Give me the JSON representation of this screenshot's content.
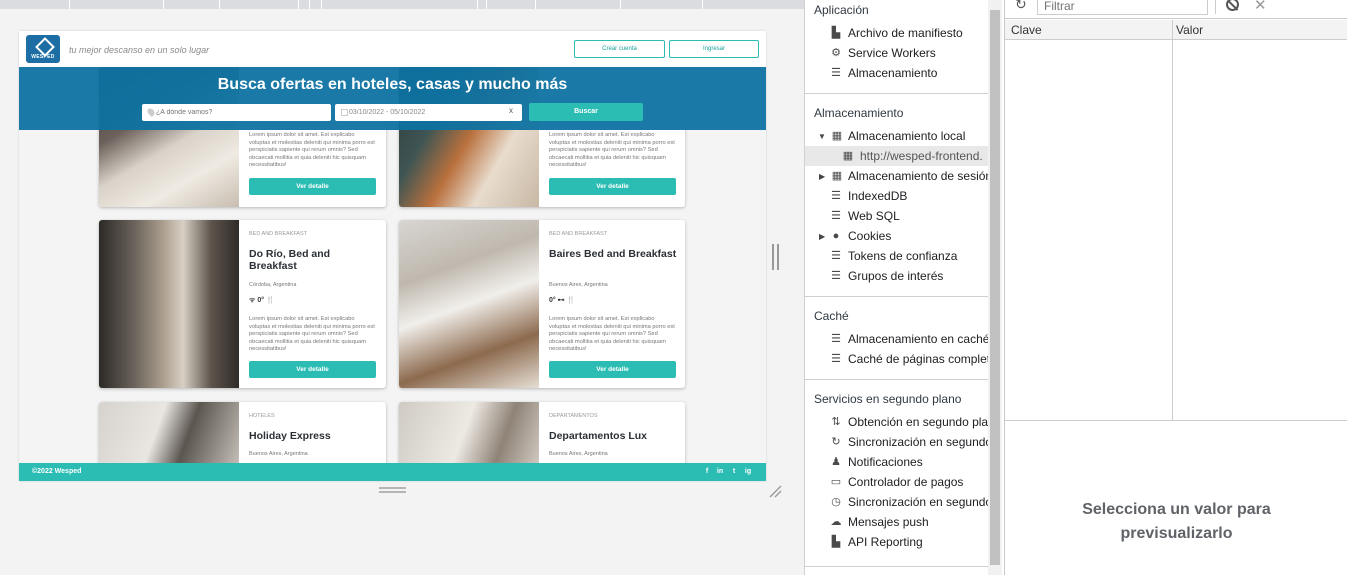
{
  "site": {
    "tagline": "tu mejor descanso en un solo lugar",
    "logo_text": "WESPED",
    "create_account": "Crear cuenta",
    "login": "Ingresar",
    "hero_title": "Busca ofertas en hoteles, casas y mucho más",
    "search_placeholder": "¿A dónde vamos?",
    "date_range": "03/10/2022 - 05/10/2022",
    "clear": "x",
    "search_button": "Buscar",
    "cards": [
      {
        "category": "",
        "name": "",
        "location": "",
        "amenities": "",
        "description": "Lorem ipsum dolor sit amet. Est explicabo voluptas et molestias deleniti qui minima porro est perspiciatis sapiente qui rerum omnis? Sed obcaecati mollitia et quia deleniti hic quisquam necessitatibus!",
        "button": "Ver detalle"
      },
      {
        "category": "",
        "name": "",
        "location": "",
        "amenities": "",
        "description": "Lorem ipsum dolor sit amet. Est explicabo voluptas et molestias deleniti qui minima porro est perspiciatis sapiente qui rerum omnis? Sed obcaecati mollitia et quia deleniti hic quisquam necessitatibus!",
        "button": "Ver detalle"
      },
      {
        "category": "BED AND BREAKFAST",
        "name": "Do Río, Bed and Breakfast",
        "location": "Córdoba, Argentina",
        "amenities": "ᯤ 0° 🍴",
        "description": "Lorem ipsum dolor sit amet. Est explicabo voluptas et molestias deleniti qui minima porro est perspiciatis sapiente qui rerum omnis? Sed obcaecati mollitia et quia deleniti hic quisquam necessitatibus!",
        "button": "Ver detalle"
      },
      {
        "category": "BED AND BREAKFAST",
        "name": "Baires Bed and Breakfast",
        "location": "Buenos Aires, Argentina",
        "amenities": "0° ⊷ 🍴",
        "description": "Lorem ipsum dolor sit amet. Est explicabo voluptas et molestias deleniti qui minima porro est perspiciatis sapiente qui rerum omnis? Sed obcaecati mollitia et quia deleniti hic quisquam necessitatibus!",
        "button": "Ver detalle"
      },
      {
        "category": "HOTELES",
        "name": "Holiday Express",
        "location": "Buenos Aires, Argentina",
        "amenities": "",
        "description": "",
        "button": ""
      },
      {
        "category": "DEPARTAMENTOS",
        "name": "Departamentos Lux",
        "location": "Buenos Aires, Argentina",
        "amenities": "",
        "description": "",
        "button": ""
      }
    ],
    "footer_copy": "©2022 Wesped",
    "social": [
      "f",
      "in",
      "t",
      "ig"
    ]
  },
  "sidebar": {
    "sections": [
      {
        "title": "Aplicación",
        "items": [
          {
            "label": "Archivo de manifiesto",
            "icon": "file-icon"
          },
          {
            "label": "Service Workers",
            "icon": "gear-icon"
          },
          {
            "label": "Almacenamiento",
            "icon": "database-icon"
          }
        ]
      },
      {
        "title": "Almacenamiento",
        "items": [
          {
            "label": "Almacenamiento local",
            "icon": "table-icon",
            "expanded": true
          },
          {
            "label": "http://wesped-frontend.",
            "icon": "table-icon",
            "selected": true
          },
          {
            "label": "Almacenamiento de sesión",
            "icon": "table-icon",
            "collapsed": true
          },
          {
            "label": "IndexedDB",
            "icon": "database-icon"
          },
          {
            "label": "Web SQL",
            "icon": "database-icon"
          },
          {
            "label": "Cookies",
            "icon": "cookie-icon",
            "collapsed": true
          },
          {
            "label": "Tokens de confianza",
            "icon": "database-icon"
          },
          {
            "label": "Grupos de interés",
            "icon": "database-icon"
          }
        ]
      },
      {
        "title": "Caché",
        "items": [
          {
            "label": "Almacenamiento en caché",
            "icon": "database-icon"
          },
          {
            "label": "Caché de páginas completas",
            "icon": "database-icon"
          }
        ]
      },
      {
        "title": "Servicios en segundo plano",
        "items": [
          {
            "label": "Obtención en segundo plano",
            "icon": "arrows-updown-icon"
          },
          {
            "label": "Sincronización en segundo plano",
            "icon": "sync-icon"
          },
          {
            "label": "Notificaciones",
            "icon": "bell-icon"
          },
          {
            "label": "Controlador de pagos",
            "icon": "card-icon"
          },
          {
            "label": "Sincronización en segundo plano",
            "icon": "clock-icon"
          },
          {
            "label": "Mensajes push",
            "icon": "cloud-icon"
          },
          {
            "label": "API Reporting",
            "icon": "file-icon"
          }
        ]
      }
    ]
  },
  "storage": {
    "filter_placeholder": "Filtrar",
    "col_key": "Clave",
    "col_value": "Valor",
    "preview_line1": "Selecciona un valor para",
    "preview_line2": "previsualizarlo"
  }
}
